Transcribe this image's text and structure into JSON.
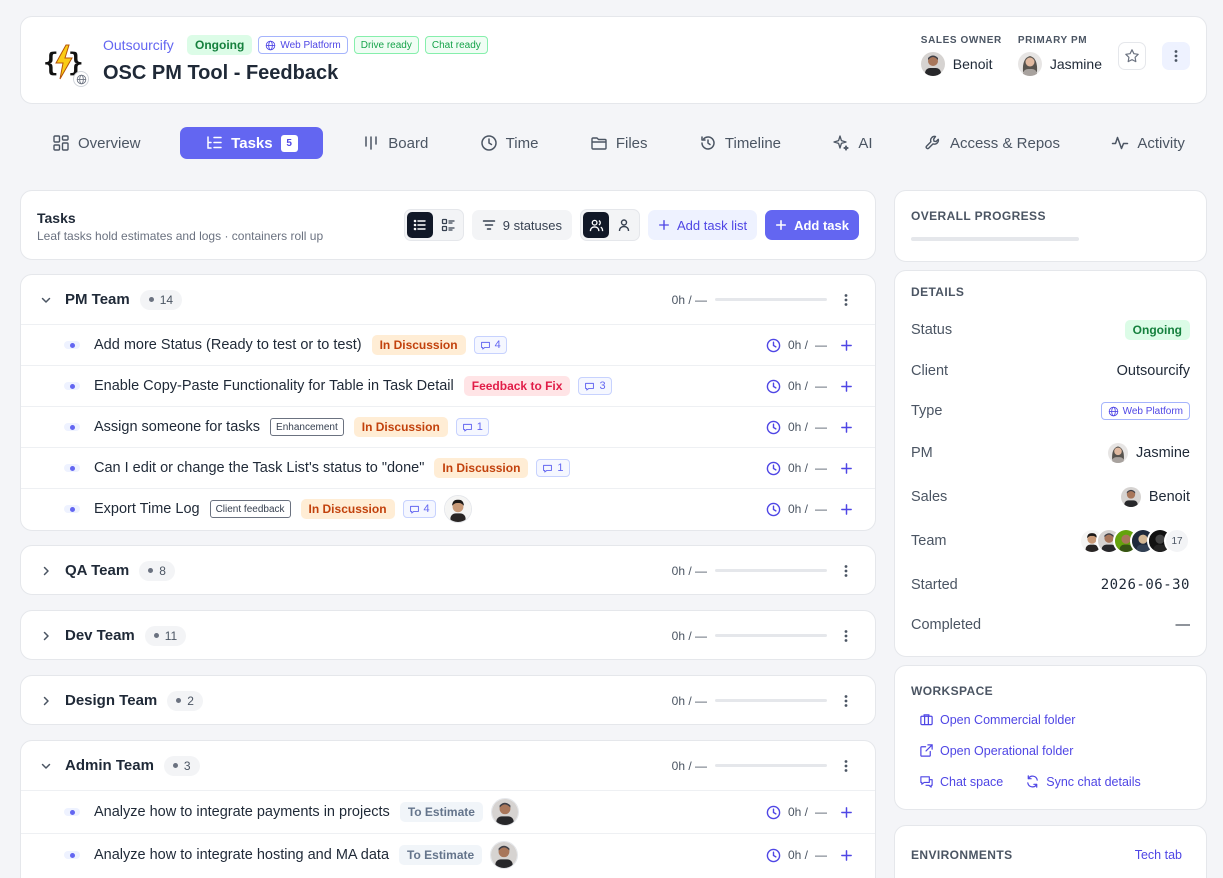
{
  "header": {
    "client": "Outsourcify",
    "status": "Ongoing",
    "platform": "Web Platform",
    "drive_badge": "Drive ready",
    "chat_badge": "Chat ready",
    "title": "OSC PM Tool - Feedback",
    "sales_owner_label": "SALES OWNER",
    "sales_owner": "Benoit",
    "primary_pm_label": "PRIMARY PM",
    "primary_pm": "Jasmine"
  },
  "tabs": [
    {
      "label": "Overview",
      "icon": "grid-icon"
    },
    {
      "label": "Tasks",
      "icon": "list-icon",
      "count": "5"
    },
    {
      "label": "Board",
      "icon": "columns-icon"
    },
    {
      "label": "Time",
      "icon": "clock-icon"
    },
    {
      "label": "Files",
      "icon": "folder-icon"
    },
    {
      "label": "Timeline",
      "icon": "history-icon"
    },
    {
      "label": "AI",
      "icon": "sparkles-icon"
    },
    {
      "label": "Access & Repos",
      "icon": "wrench-icon"
    },
    {
      "label": "Activity",
      "icon": "activity-icon"
    }
  ],
  "tasks_panel": {
    "title": "Tasks",
    "subtitle": "Leaf tasks hold estimates and logs · containers roll up",
    "statuses_filter": "9 statuses",
    "add_list": "Add task list",
    "add_task": "Add task"
  },
  "groups": [
    {
      "name": "PM Team",
      "count": "14",
      "time": "0h / —",
      "expanded": true,
      "tasks": [
        {
          "title": "Add more Status (Ready to test or to test)",
          "status": "In Discussion",
          "comments": "4",
          "time": "0h /",
          "dash": "—"
        },
        {
          "title": "Enable Copy-Paste Functionality for Table in Task Detail",
          "status": "Feedback to Fix",
          "comments": "3",
          "time": "0h /",
          "dash": "—"
        },
        {
          "title": "Assign someone for tasks",
          "tag": "Enhancement",
          "status": "In Discussion",
          "comments": "1",
          "time": "0h /",
          "dash": "—"
        },
        {
          "title": "Can I edit or change the Task List's status to \"done\"",
          "status": "In Discussion",
          "comments": "1",
          "time": "0h /",
          "dash": "—"
        },
        {
          "title": "Export Time Log",
          "tag": "Client feedback",
          "status": "In Discussion",
          "comments": "4",
          "time": "0h /",
          "dash": "—"
        }
      ]
    },
    {
      "name": "QA Team",
      "count": "8",
      "time": "0h / —",
      "expanded": false
    },
    {
      "name": "Dev Team",
      "count": "11",
      "time": "0h / —",
      "expanded": false
    },
    {
      "name": "Design Team",
      "count": "2",
      "time": "0h / —",
      "expanded": false
    },
    {
      "name": "Admin Team",
      "count": "3",
      "time": "0h / —",
      "expanded": true,
      "tasks": [
        {
          "title": "Analyze how to integrate payments in projects",
          "status": "To Estimate",
          "time": "0h /",
          "dash": "—"
        },
        {
          "title": "Analyze how to integrate hosting and MA data",
          "status": "To Estimate",
          "time": "0h /",
          "dash": "—"
        }
      ]
    }
  ],
  "overall_progress": {
    "title": "OVERALL PROGRESS",
    "value": 0
  },
  "details": {
    "title": "DETAILS",
    "status_label": "Status",
    "status": "Ongoing",
    "client_label": "Client",
    "client": "Outsourcify",
    "type_label": "Type",
    "type": "Web Platform",
    "pm_label": "PM",
    "pm": "Jasmine",
    "sales_label": "Sales",
    "sales": "Benoit",
    "team_label": "Team",
    "team_more": "17",
    "started_label": "Started",
    "started": "2026-06-30",
    "completed_label": "Completed",
    "completed": "—"
  },
  "workspace": {
    "title": "WORKSPACE",
    "commercial": "Open Commercial folder",
    "operational": "Open Operational folder",
    "chat": "Chat space",
    "sync": "Sync chat details"
  },
  "environments": {
    "title": "ENVIRONMENTS",
    "tech_tab": "Tech tab"
  },
  "colors": {
    "accent": "#6366f1",
    "ongoing": "#15803d",
    "discussion": "#c2410c",
    "fix": "#e11d48"
  }
}
